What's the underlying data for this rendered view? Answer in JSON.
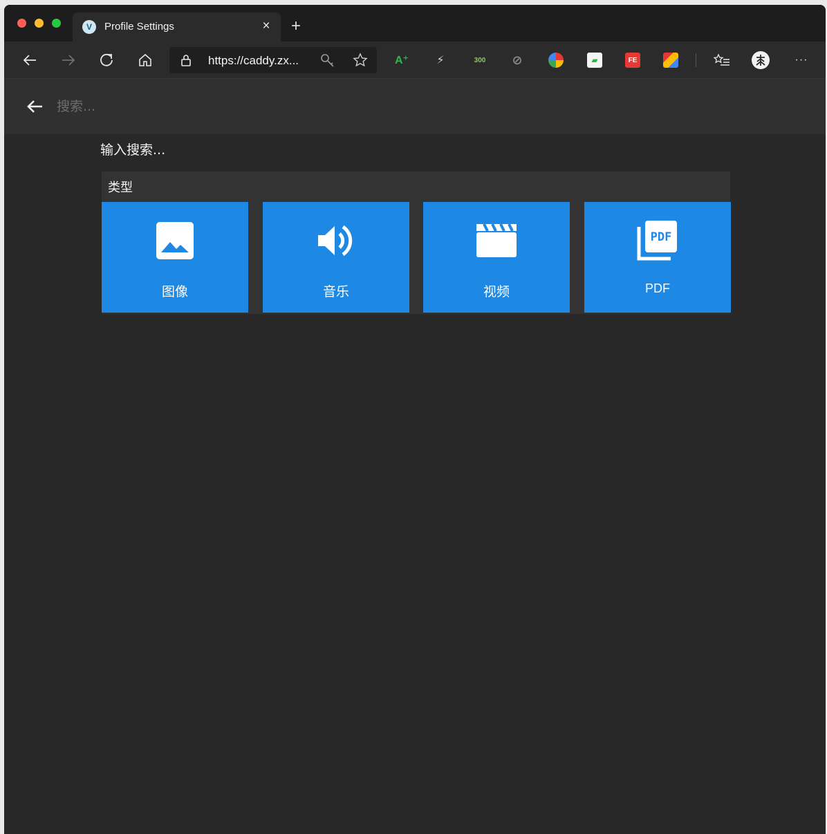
{
  "browser": {
    "tab_title": "Profile Settings",
    "tab_favicon": "V",
    "close_tab_glyph": "×",
    "new_tab_glyph": "+",
    "address_url": "https://caddy.zx...",
    "more_glyph": "···",
    "extensions": [
      {
        "name": "translate-extension-icon",
        "text": "A⁺",
        "color": "#2fb84a"
      },
      {
        "name": "bolt-extension-icon",
        "text": "⚡",
        "color": "#d0d0d0"
      },
      {
        "name": "counter-extension-icon",
        "text": "300",
        "color": "#8fc46a"
      },
      {
        "name": "block-extension-icon",
        "text": "⊘",
        "color": "#8a8a8a"
      },
      {
        "name": "color-wheel-extension-icon",
        "text": "",
        "color": "#f0a030"
      },
      {
        "name": "green-flag-extension-icon",
        "text": "▰",
        "color": "#2fb84a"
      },
      {
        "name": "fe-extension-icon",
        "text": "FE",
        "color": "#e53935"
      },
      {
        "name": "puzzle-extension-icon",
        "text": "",
        "color": "#fbbc05"
      }
    ]
  },
  "search": {
    "placeholder": "搜索...",
    "hint": "输入搜索..."
  },
  "category_panel": {
    "title": "类型",
    "tiles": [
      {
        "label": "图像",
        "icon": "image-icon"
      },
      {
        "label": "音乐",
        "icon": "volume-icon"
      },
      {
        "label": "视频",
        "icon": "clapperboard-icon"
      },
      {
        "label": "PDF",
        "icon": "pdf-icon",
        "icon_text": "PDF"
      }
    ]
  },
  "colors": {
    "tile_blue": "#1e88e5",
    "background": "#282828",
    "panel": "#333333"
  }
}
